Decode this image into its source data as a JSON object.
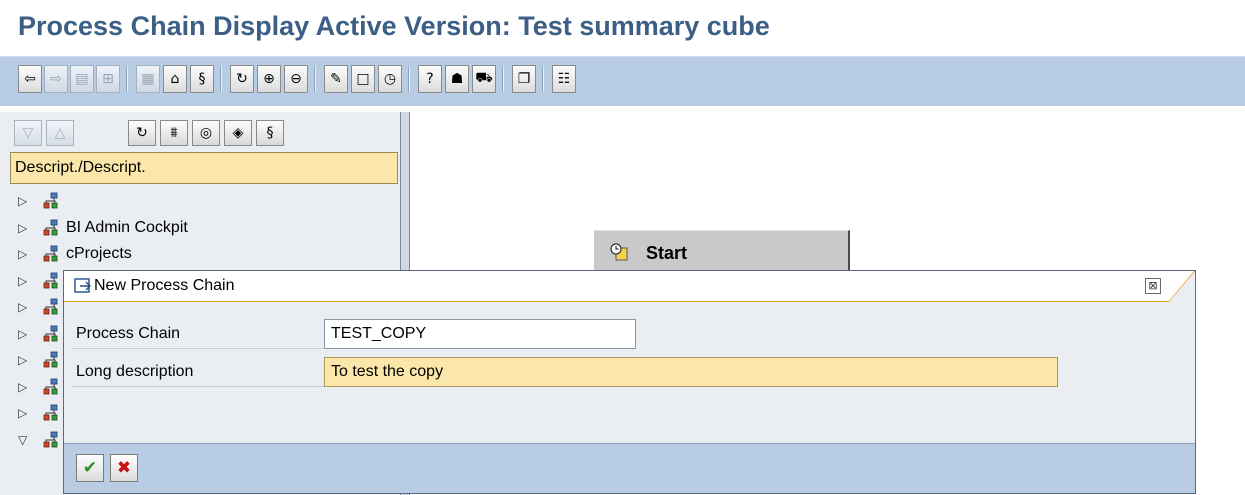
{
  "page": {
    "title": "Process Chain Display Active Version: Test summary cube"
  },
  "toolbar": {
    "buttons": [
      {
        "name": "back-button",
        "glyph": "⇦",
        "enabled": true
      },
      {
        "name": "forward-button",
        "glyph": "⇨",
        "enabled": false
      },
      {
        "name": "view-list-button",
        "glyph": "▤",
        "enabled": false
      },
      {
        "name": "view-tree-button",
        "glyph": "⊞",
        "enabled": false
      },
      {
        "name": "layout-button",
        "glyph": "▦",
        "enabled": false
      },
      {
        "name": "network-button",
        "glyph": "⌂",
        "enabled": true
      },
      {
        "name": "documentation-button",
        "glyph": "§",
        "enabled": true
      },
      {
        "name": "refresh-button",
        "glyph": "↻",
        "enabled": true
      },
      {
        "name": "zoom-in-button",
        "glyph": "⊕",
        "enabled": true
      },
      {
        "name": "zoom-out-button",
        "glyph": "⊖",
        "enabled": true
      },
      {
        "name": "change-button",
        "glyph": "✎",
        "enabled": true
      },
      {
        "name": "new-button",
        "glyph": "□",
        "enabled": true
      },
      {
        "name": "schedule-button",
        "glyph": "◷",
        "enabled": true
      },
      {
        "name": "help-button",
        "glyph": "?",
        "enabled": true
      },
      {
        "name": "user-button",
        "glyph": "☗",
        "enabled": true
      },
      {
        "name": "transport-button",
        "glyph": "⛟",
        "enabled": true
      },
      {
        "name": "copy-button",
        "glyph": "❐",
        "enabled": true
      },
      {
        "name": "details-button",
        "glyph": "☷",
        "enabled": true
      }
    ]
  },
  "left_pane": {
    "toolbar_buttons": [
      {
        "name": "expand-down-button",
        "glyph": "▽",
        "enabled": false
      },
      {
        "name": "collapse-up-button",
        "glyph": "△",
        "enabled": false
      },
      {
        "name": "refresh-tree-button",
        "glyph": "↻",
        "enabled": true
      },
      {
        "name": "filter-button",
        "glyph": "⩩",
        "enabled": true
      },
      {
        "name": "target-button",
        "glyph": "◎",
        "enabled": true
      },
      {
        "name": "favorite-button",
        "glyph": "◈",
        "enabled": true
      },
      {
        "name": "documentation-tree-button",
        "glyph": "§",
        "enabled": true
      }
    ],
    "column_header": "Descript./Descript.",
    "tree_items": [
      {
        "label": "",
        "expander": "▷"
      },
      {
        "label": "BI Admin Cockpit",
        "expander": "▷"
      },
      {
        "label": "cProjects",
        "expander": "▷"
      },
      {
        "label": "",
        "expander": "▷"
      },
      {
        "label": "",
        "expander": "▷"
      },
      {
        "label": "",
        "expander": "▷"
      },
      {
        "label": "",
        "expander": "▷"
      },
      {
        "label": "",
        "expander": "▷"
      },
      {
        "label": "",
        "expander": "▷"
      },
      {
        "label": "",
        "expander": "▽"
      }
    ]
  },
  "canvas": {
    "start_node": {
      "label": "Start"
    }
  },
  "dialog": {
    "title": "New Process Chain",
    "close_glyph": "⊠",
    "fields": [
      {
        "label": "Process Chain",
        "value": "TEST_COPY"
      },
      {
        "label": "Long description",
        "value": "To test the copy"
      }
    ],
    "buttons": [
      {
        "name": "confirm-button",
        "glyph": "✔",
        "color": "#2e8b2e"
      },
      {
        "name": "cancel-button",
        "glyph": "✖",
        "color": "#cc1111"
      }
    ]
  },
  "colors": {
    "title_blue": "#3d5f86",
    "toolbar_bg": "#b8cde4",
    "highlight_yellow": "#fbe7a9",
    "dialog_accent": "#e8a020"
  }
}
